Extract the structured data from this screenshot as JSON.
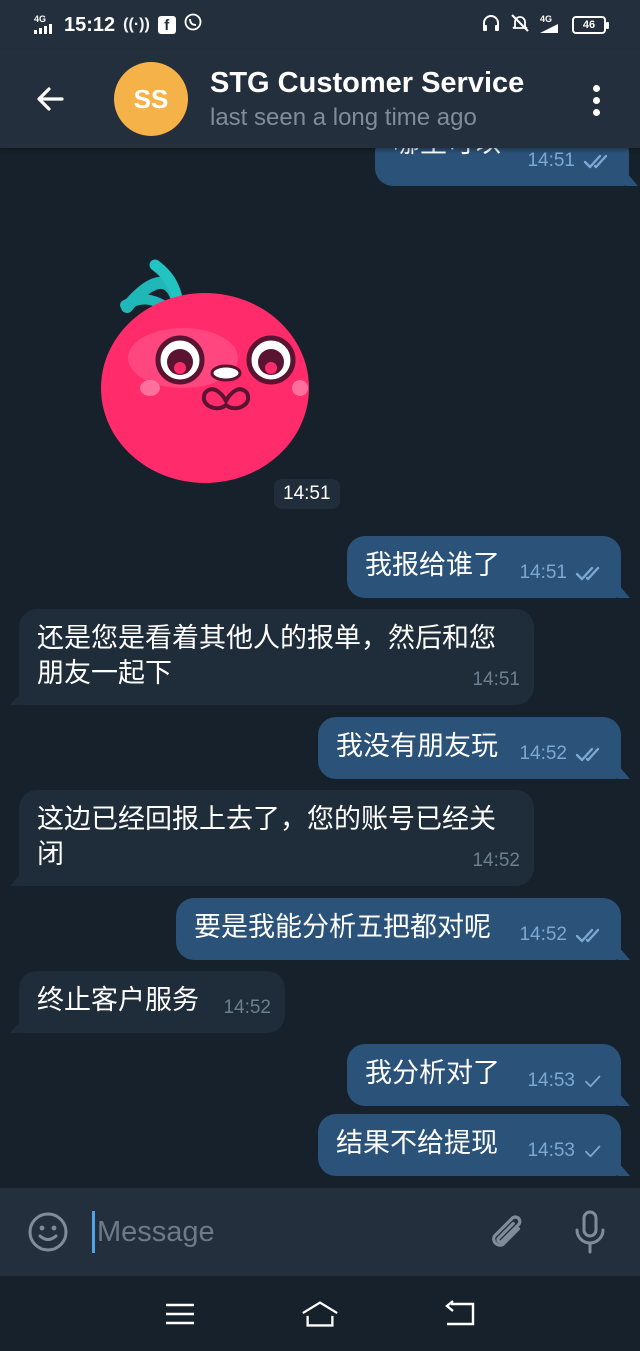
{
  "status_bar": {
    "time": "15:12",
    "network_left": "4G",
    "network_right": "4G",
    "battery": "46"
  },
  "header": {
    "avatar_initials": "SS",
    "avatar_color": "#f5b249",
    "title": "STG Customer Service",
    "subtitle": "last seen a long time ago"
  },
  "messages": [
    {
      "direction": "out",
      "text": "哪里可以",
      "time": "14:51",
      "status": "read"
    },
    {
      "direction": "in",
      "type": "sticker",
      "sticker": "cherry-sticker",
      "time": "14:51"
    },
    {
      "direction": "out",
      "text": "我报给谁了",
      "time": "14:51",
      "status": "read"
    },
    {
      "direction": "in",
      "text_line1": "还是您是看着其他人的报单，然后和您",
      "text_line2": "朋友一起下",
      "time": "14:51"
    },
    {
      "direction": "out",
      "text": "我没有朋友玩",
      "time": "14:52",
      "status": "read"
    },
    {
      "direction": "in",
      "text_line1": "这边已经回报上去了，您的账号已经关",
      "text_line2": "闭",
      "time": "14:52"
    },
    {
      "direction": "out",
      "text": "要是我能分析五把都对呢",
      "time": "14:52",
      "status": "read"
    },
    {
      "direction": "in",
      "text": "终止客户服务",
      "time": "14:52"
    },
    {
      "direction": "out",
      "text": "我分析对了",
      "time": "14:53",
      "status": "sent"
    },
    {
      "direction": "out",
      "text": "结果不给提现",
      "time": "14:53",
      "status": "sent"
    }
  ],
  "input": {
    "placeholder": "Message"
  },
  "colors": {
    "background": "#17212b",
    "header": "#242f3d",
    "outgoing_bubble": "#2b5278",
    "incoming_bubble": "#1f2c3a",
    "accent": "#4fa3e7"
  }
}
